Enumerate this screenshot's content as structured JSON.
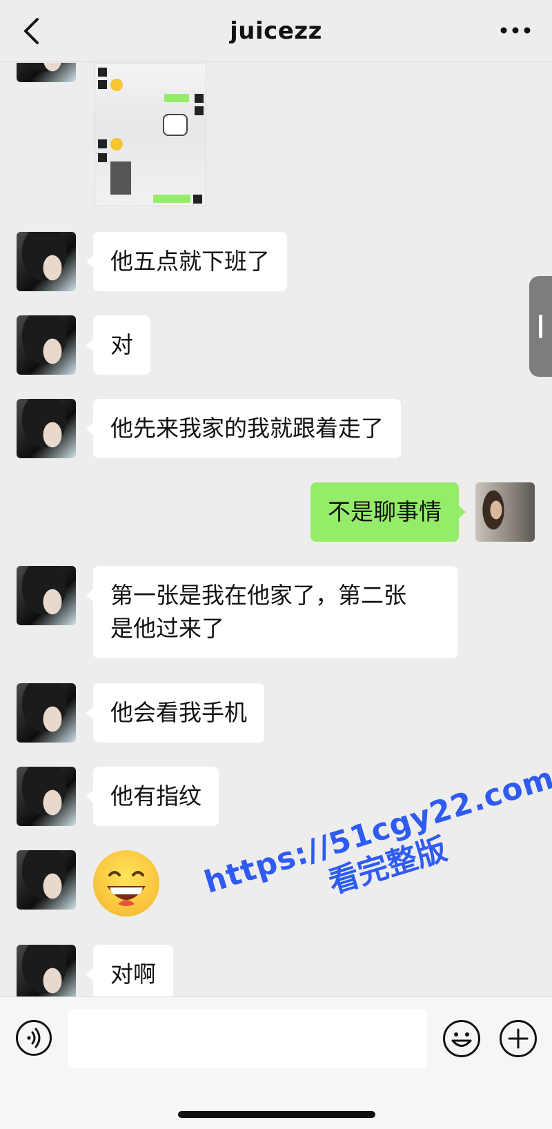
{
  "header": {
    "title": "juicezz",
    "back_icon": "chevron-left-icon",
    "more_icon": "more-dots-icon"
  },
  "shared_image": {
    "icon": "image-thumbnail"
  },
  "messages": [
    {
      "side": "in",
      "text": "他五点就下班了"
    },
    {
      "side": "in",
      "text": "对"
    },
    {
      "side": "in",
      "text": "他先来我家的我就跟着走了"
    },
    {
      "side": "out",
      "text": "不是聊事情"
    },
    {
      "side": "in",
      "text": "第一张是我在他家了，第二张\n是他过来了"
    },
    {
      "side": "in",
      "text": "他会看我手机"
    },
    {
      "side": "in",
      "text": "他有指纹"
    },
    {
      "side": "in",
      "emoji": "grinning-face-emoji"
    },
    {
      "side": "in",
      "text": "对啊"
    }
  ],
  "input_bar": {
    "voice_icon": "voice-icon",
    "input_value": "",
    "emoji_icon": "emoji-icon",
    "plus_icon": "plus-icon"
  },
  "watermark": {
    "url": "https://51cgy22.com",
    "text": "看完整版"
  },
  "colors": {
    "background": "#ededed",
    "incoming_bubble": "#ffffff",
    "outgoing_bubble": "#95ec69",
    "watermark": "#2f5bf2"
  }
}
